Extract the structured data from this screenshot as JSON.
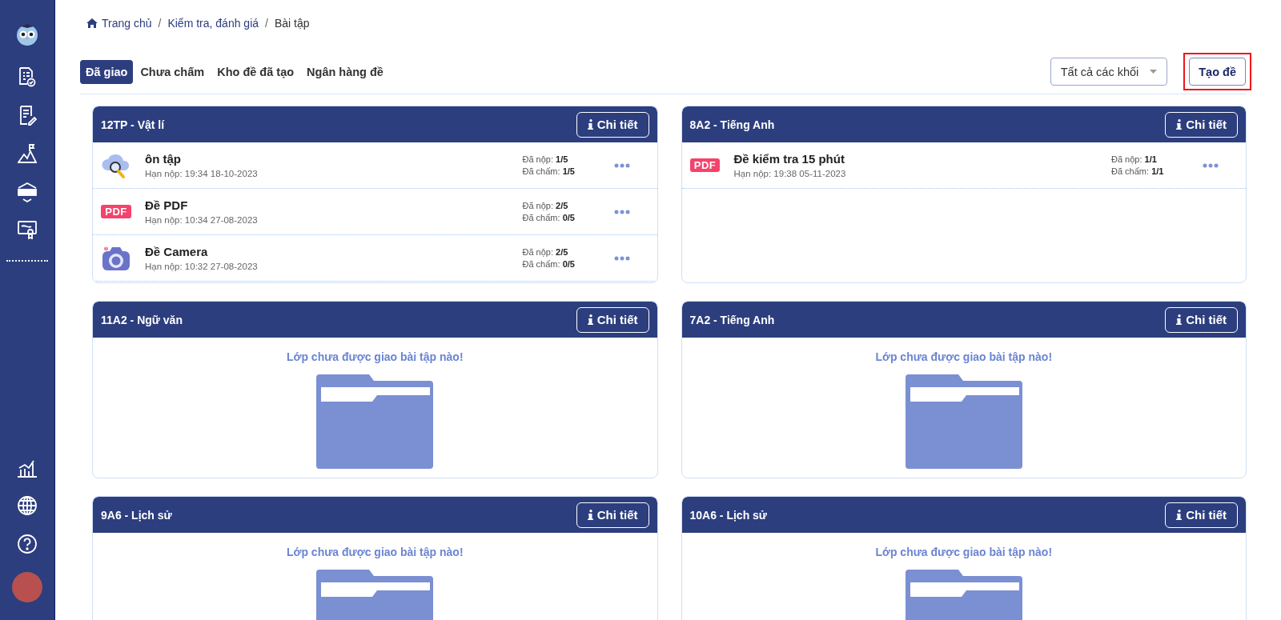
{
  "breadcrumb": {
    "separator": "/",
    "items": [
      "Trang chủ",
      "Kiểm tra, đánh giá",
      "Bài tập"
    ]
  },
  "tabs": [
    {
      "label": "Đã giao",
      "selected": true
    },
    {
      "label": "Chưa chấm",
      "selected": false
    },
    {
      "label": "Kho đề đã tạo",
      "selected": false
    },
    {
      "label": "Ngân hàng đề",
      "selected": false
    }
  ],
  "grade_filter": {
    "value": "Tất cả các khối"
  },
  "create_button": {
    "label": "Tạo đề",
    "highlighted": true
  },
  "cards": [
    {
      "title": "12TP - Vật lí",
      "detail_button": "Chi tiết",
      "items": [
        {
          "kind": "cloud",
          "title": "ôn tập",
          "deadline": "Hạn nộp: 19:34 18-10-2023",
          "submitted": "Đã nộp: **1/5**",
          "graded": "Đã chấm: **1/5**"
        },
        {
          "kind": "pdf",
          "badge": "PDF",
          "title": "Đề PDF",
          "deadline": "Hạn nộp: 10:34 27-08-2023",
          "submitted": "Đã nộp: **2/5**",
          "graded": "Đã chấm: **0/5**"
        },
        {
          "kind": "camera",
          "title": "Đề Camera",
          "deadline": "Hạn nộp: 10:32 27-08-2023",
          "submitted": "Đã nộp: **2/5**",
          "graded": "Đã chấm: **0/5**"
        }
      ]
    },
    {
      "title": "8A2 - Tiếng Anh",
      "detail_button": "Chi tiết",
      "items": [
        {
          "kind": "pdf",
          "badge": "PDF",
          "title": "Đề kiểm tra 15 phút",
          "deadline": "Hạn nộp: 19:38 05-11-2023",
          "submitted": "Đã nộp: **1/1**",
          "graded": "Đã chấm: **1/1**"
        }
      ]
    },
    {
      "title": "11A2 - Ngữ văn",
      "detail_button": "Chi tiết",
      "empty_message": "Lớp chưa được giao bài tập nào!"
    },
    {
      "title": "7A2 - Tiếng Anh",
      "detail_button": "Chi tiết",
      "empty_message": "Lớp chưa được giao bài tập nào!"
    },
    {
      "title": "9A6 - Lịch sử",
      "detail_button": "Chi tiết",
      "empty_message": "Lớp chưa được giao bài tập nào!"
    },
    {
      "title": "10A6 - Lịch sử",
      "detail_button": "Chi tiết",
      "empty_message": "Lớp chưa được giao bài tập nào!"
    }
  ]
}
